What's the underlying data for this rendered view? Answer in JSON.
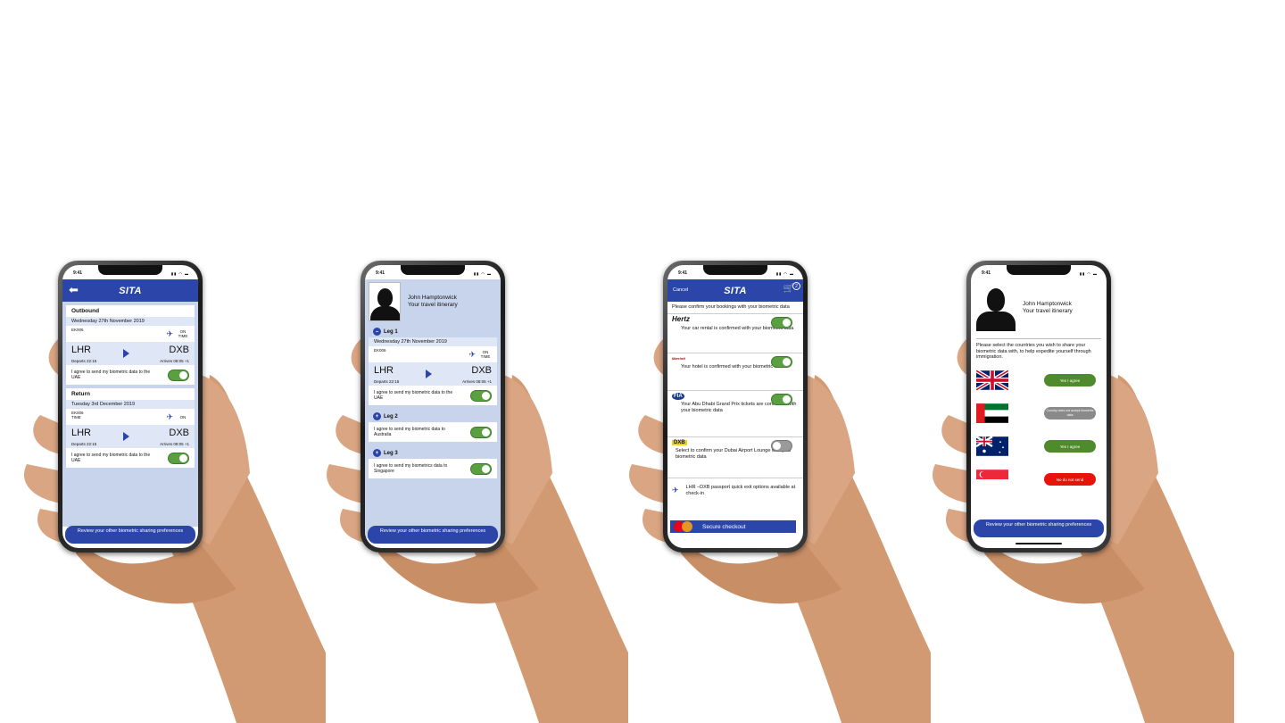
{
  "status": {
    "time": "9:41"
  },
  "phone1": {
    "brand": "SITA",
    "outbound": {
      "heading": "Outbound",
      "date": "Wednesday 27th November 2019",
      "flight": "EK006",
      "status": "ON TIME",
      "from": "LHR",
      "to": "DXB",
      "departs": "Departs 22:15",
      "arrives": "Arrives 08:05 +1",
      "agree": "I agree to send my biometric data to the UAE"
    },
    "return": {
      "heading": "Return",
      "date": "Tuesday 3rd December 2019",
      "flight": "EK006",
      "flight_sub": "TIME",
      "status": "ON",
      "from": "LHR",
      "to": "DXB",
      "departs": "Departs 22:15",
      "arrives": "Arrives 08:05 +1",
      "agree": "I agree to send my biometric data to the UAE"
    },
    "review": "Review your other biometric sharing preferences"
  },
  "phone2": {
    "name": "John Hamptonwick",
    "subtitle": "Your travel itinerary",
    "leg1": {
      "label": "Leg 1",
      "date": "Wednesday 27th November 2019",
      "flight": "EK006",
      "status": "ON TIME",
      "from": "LHR",
      "to": "DXB",
      "departs": "Departs 22:15",
      "arrives": "Arrives 08:05 +1",
      "agree": "I agree to send my biometric data to the UAE"
    },
    "leg2": {
      "label": "Leg 2",
      "agree": "I agree to send my biometric data to Australia"
    },
    "leg3": {
      "label": "Leg 3",
      "agree": "I agree to send my biometrics data to Singapore"
    },
    "review": "Review your other biometric sharing preferences"
  },
  "phone3": {
    "cancel": "Cancel",
    "brand": "SITA",
    "cart_count": "2",
    "intro": "Please confirm your bookings with your biometric data",
    "bookings": [
      {
        "brand": "Hertz",
        "desc": "Your car rental is confirmed with your biometric data",
        "on": true
      },
      {
        "brand": "Marriott",
        "desc": "Your hotel is confirmed with your biometric data",
        "on": true
      },
      {
        "brand": "FIA",
        "desc": "Your Abu Dhabi Grand Prix tickets are confirmed with your biometric data",
        "on": true
      },
      {
        "brand": "DXB",
        "desc": "Select to confirm your Dubai Airport Lounge with your biometric data",
        "on": false
      }
    ],
    "passport": "LHR –DXB passport quick exit options available at check-in",
    "checkout": "Secure checkout"
  },
  "phone4": {
    "name": "John Hamptonwick",
    "subtitle": "Your travel itinerary",
    "intro": "Please select the countries you wish to share your biometric data with, to help expedite yourself through immigration.",
    "countries": [
      {
        "flag": "uk-flag",
        "label": "Yes I agree",
        "state": "yes"
      },
      {
        "flag": "uae-flag",
        "label": "Country does not accept biometric data",
        "state": "na"
      },
      {
        "flag": "australia-flag",
        "label": "Yes I agree",
        "state": "yes"
      },
      {
        "flag": "singapore-flag",
        "label": "No do not send",
        "state": "no"
      }
    ],
    "review": "Review your other biometric sharing preferences"
  },
  "colors": {
    "brand_blue": "#2b45a8",
    "toggle_green": "#5aa040",
    "deny_red": "#e8140c"
  }
}
